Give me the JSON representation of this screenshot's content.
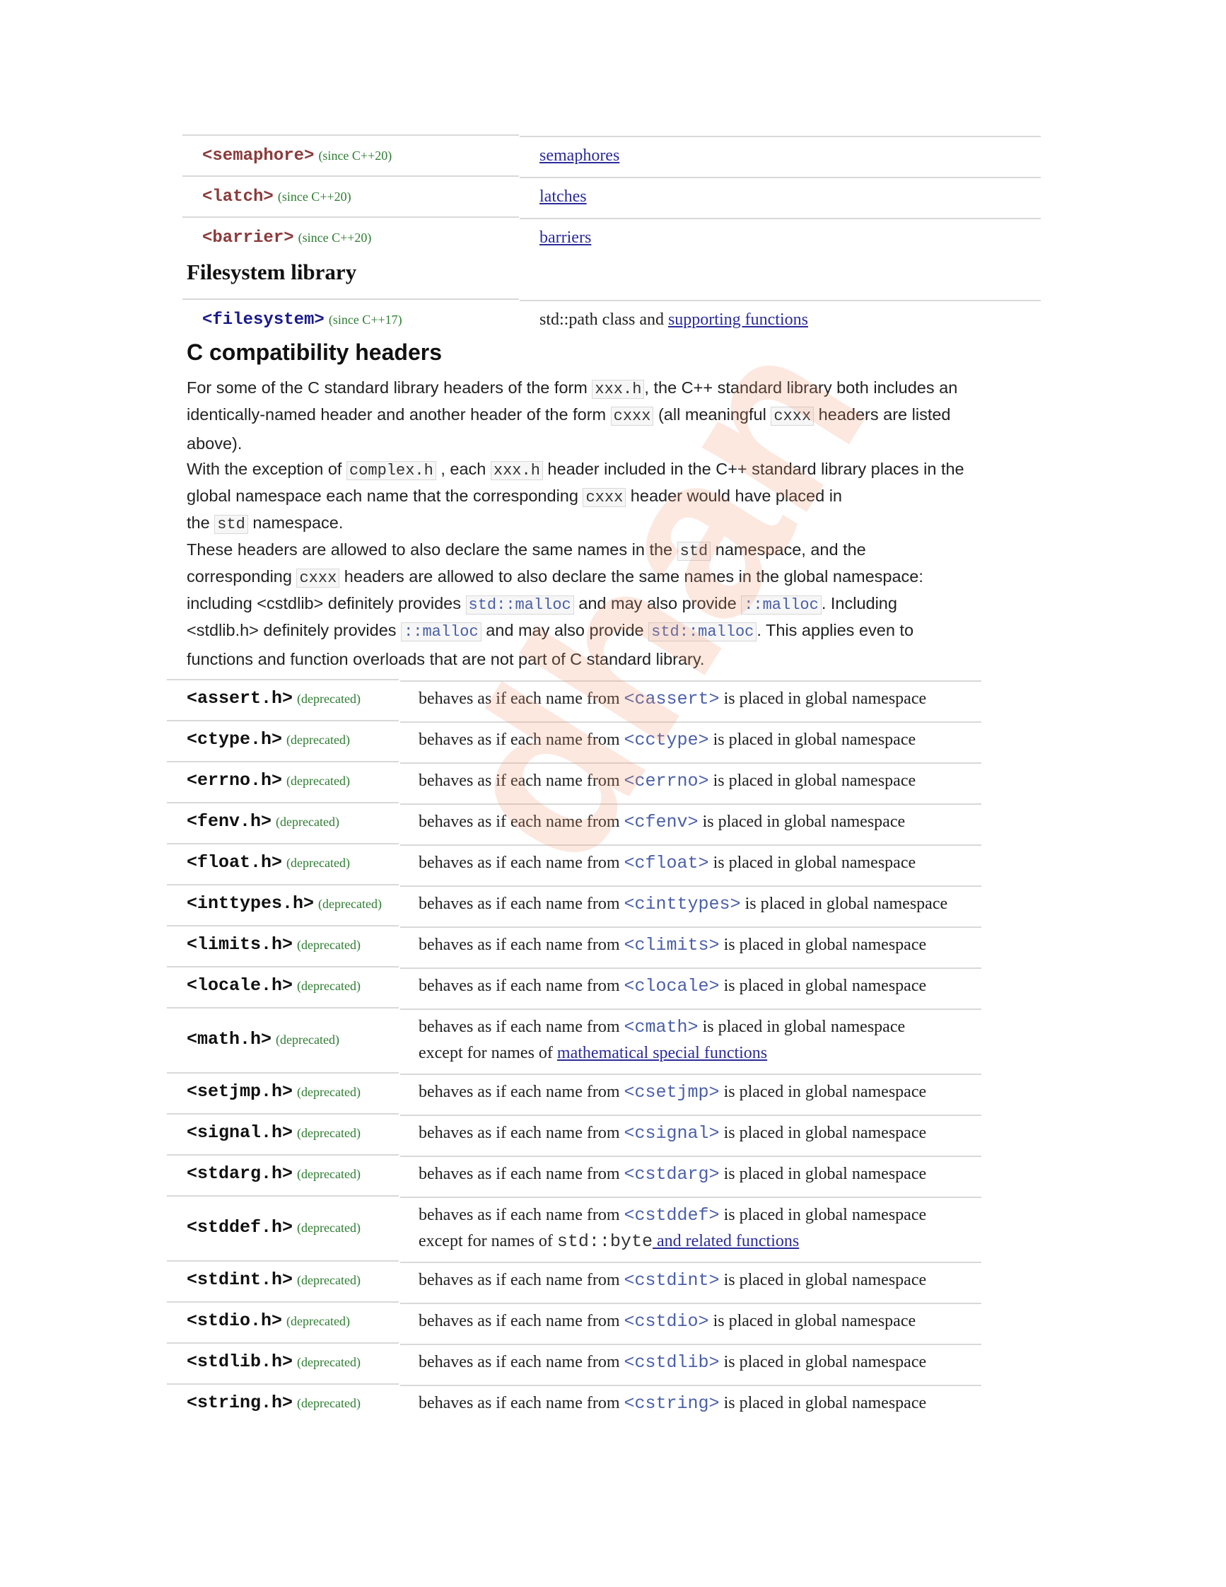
{
  "top_table": [
    {
      "header": "<semaphore>",
      "since": "(since C++20)",
      "desc_link": "semaphores"
    },
    {
      "header": "<latch>",
      "since": "(since C++20)",
      "desc_link": "latches"
    },
    {
      "header": "<barrier>",
      "since": "(since C++20)",
      "desc_link": "barriers"
    }
  ],
  "filesystem": {
    "title": "Filesystem library",
    "header": "<filesystem>",
    "since": "(since C++17)",
    "desc_text": "std::path class and ",
    "desc_link": "supporting functions"
  },
  "ccompat": {
    "title": "C compatibility headers",
    "p1": {
      "l1_a": "For some of the C standard library headers of the form ",
      "l1_code": "xxx.h",
      "l1_b": ", the C++ standard library both includes an",
      "l2_a": "identically-named header and another header of the form ",
      "l2_code": "cxxx",
      "l2_b": " (all meaningful ",
      "l2_code2": "cxxx",
      "l2_c": " headers are listed",
      "l3": "above)."
    },
    "p2": {
      "l1_a": "With the exception of ",
      "l1_code": "complex.h",
      "l1_b": " , each ",
      "l1_code2": "xxx.h",
      "l1_c": " header included in the C++ standard library places in the",
      "l2_a": "global namespace each name that the corresponding ",
      "l2_code": "cxxx",
      "l2_b": " header would have placed in",
      "l3_a": "the ",
      "l3_code": "std",
      "l3_b": " namespace."
    },
    "p3": {
      "l1_a": "These headers are allowed to also declare the same names in the ",
      "l1_code": "std",
      "l1_b": " namespace, and the",
      "l2_a": "corresponding ",
      "l2_code": "cxxx",
      "l2_b": " headers are allowed to also declare the same names in the global namespace:",
      "l3_a": "including <cstdlib> definitely provides ",
      "l3_code": "std::malloc",
      "l3_b": " and may also provide ",
      "l3_code2": "::malloc",
      "l3_c": ". Including",
      "l4_a": "<stdlib.h> definitely provides ",
      "l4_code": "::malloc",
      "l4_b": " and may also provide ",
      "l4_code2": "std::malloc",
      "l4_c": ". This applies even to",
      "l5": "functions and function overloads that are not part of C standard library."
    }
  },
  "compat_rows": [
    {
      "header": "<assert.h>",
      "dep": "(deprecated)",
      "a": "behaves as if each name from ",
      "c": "<cassert>",
      "b": " is placed in global namespace"
    },
    {
      "header": "<ctype.h>",
      "dep": "(deprecated)",
      "a": "behaves as if each name from ",
      "c": "<cctype>",
      "b": " is placed in global namespace"
    },
    {
      "header": "<errno.h>",
      "dep": "(deprecated)",
      "a": "behaves as if each name from ",
      "c": "<cerrno>",
      "b": " is placed in global namespace"
    },
    {
      "header": "<fenv.h>",
      "dep": "(deprecated)",
      "a": "behaves as if each name from ",
      "c": "<cfenv>",
      "b": " is placed in global namespace"
    },
    {
      "header": "<float.h>",
      "dep": "(deprecated)",
      "a": "behaves as if each name from ",
      "c": "<cfloat>",
      "b": " is placed in global namespace"
    },
    {
      "header": "<inttypes.h>",
      "dep": "(deprecated)",
      "a": "behaves as if each name from ",
      "c": "<cinttypes>",
      "b": " is placed in global namespace"
    },
    {
      "header": "<limits.h>",
      "dep": "(deprecated)",
      "a": "behaves as if each name from ",
      "c": "<climits>",
      "b": " is placed in global namespace"
    },
    {
      "header": "<locale.h>",
      "dep": "(deprecated)",
      "a": "behaves as if each name from ",
      "c": "<clocale>",
      "b": " is placed in global namespace"
    },
    {
      "header": "<math.h>",
      "dep": "(deprecated)",
      "a": "behaves as if each name from ",
      "c": "<cmath>",
      "b": " is placed in global namespace",
      "l2a": "except for names of ",
      "l2link": "mathematical special functions"
    },
    {
      "header": "<setjmp.h>",
      "dep": "(deprecated)",
      "a": "behaves as if each name from ",
      "c": "<csetjmp>",
      "b": " is placed in global namespace"
    },
    {
      "header": "<signal.h>",
      "dep": "(deprecated)",
      "a": "behaves as if each name from ",
      "c": "<csignal>",
      "b": " is placed in global namespace"
    },
    {
      "header": "<stdarg.h>",
      "dep": "(deprecated)",
      "a": "behaves as if each name from ",
      "c": "<cstdarg>",
      "b": " is placed in global namespace"
    },
    {
      "header": "<stddef.h>",
      "dep": "(deprecated)",
      "a": "behaves as if each name from ",
      "c": "<cstddef>",
      "b": " is placed in global namespace",
      "l2a": "except for names of ",
      "l2code": "std::byte",
      "l2link": " and related functions"
    },
    {
      "header": "<stdint.h>",
      "dep": "(deprecated)",
      "a": "behaves as if each name from ",
      "c": "<cstdint>",
      "b": " is placed in global namespace"
    },
    {
      "header": "<stdio.h>",
      "dep": "(deprecated)",
      "a": "behaves as if each name from ",
      "c": "<cstdio>",
      "b": " is placed in global namespace"
    },
    {
      "header": "<stdlib.h>",
      "dep": "(deprecated)",
      "a": "behaves as if each name from ",
      "c": "<cstdlib>",
      "b": " is placed in global namespace"
    },
    {
      "header": "<string.h>",
      "dep": "(deprecated)",
      "a": "behaves as if each name from ",
      "c": "<cstring>",
      "b": " is placed in global namespace"
    }
  ],
  "watermark": "dhan",
  "colors": {
    "link": "#2b2b9a",
    "since_green": "#2e7d32",
    "header_maroon": "#8b3a3a",
    "code_blue": "#4a5fa8"
  }
}
